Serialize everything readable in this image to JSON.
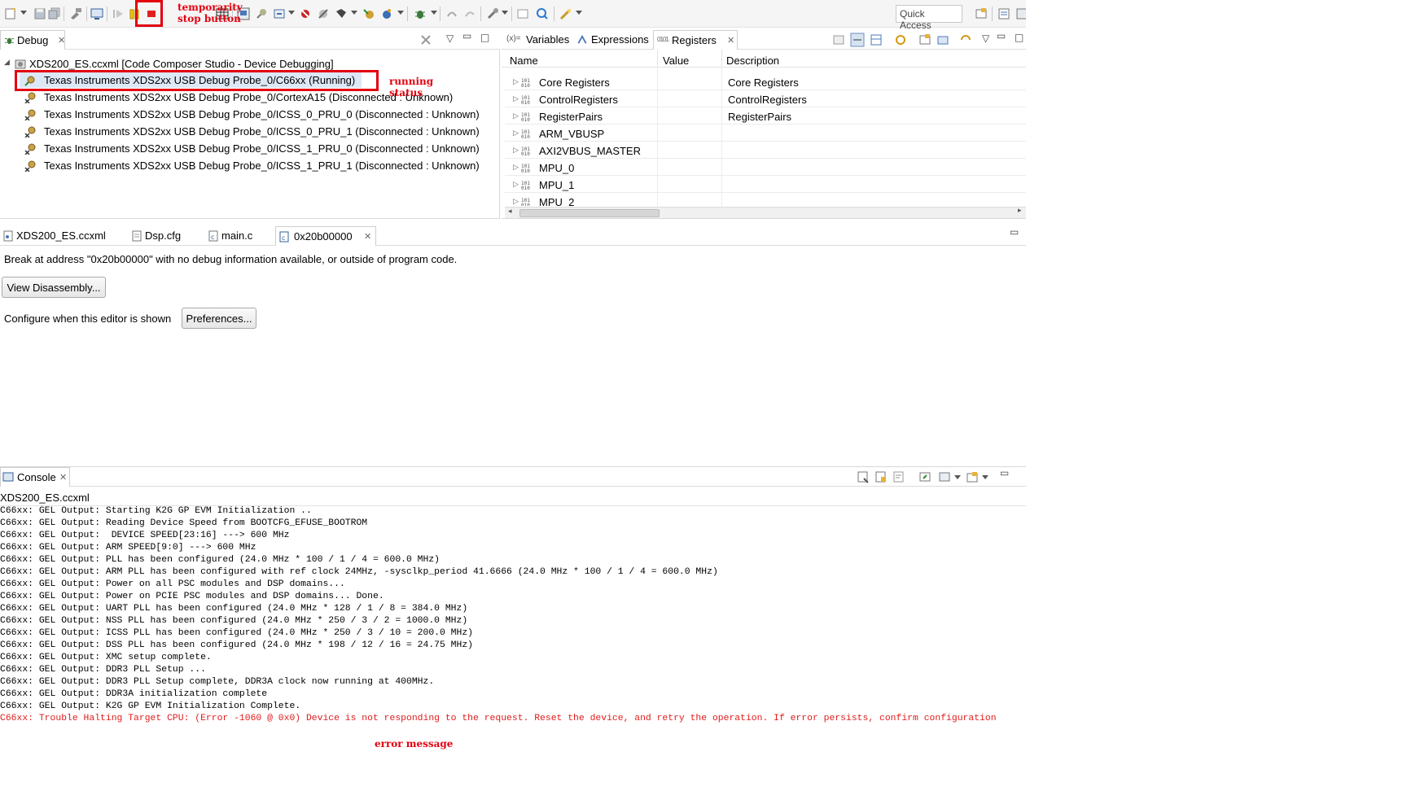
{
  "toolbar": {
    "quick_access": "Quick Access"
  },
  "debug_view": {
    "tab_label": "Debug",
    "root": "XDS200_ES.ccxml [Code Composer Studio - Device Debugging]",
    "items": [
      "Texas Instruments XDS2xx USB Debug Probe_0/C66xx (Running)",
      "Texas Instruments XDS2xx USB Debug Probe_0/CortexA15 (Disconnected : Unknown)",
      "Texas Instruments XDS2xx USB Debug Probe_0/ICSS_0_PRU_0 (Disconnected : Unknown)",
      "Texas Instruments XDS2xx USB Debug Probe_0/ICSS_0_PRU_1 (Disconnected : Unknown)",
      "Texas Instruments XDS2xx USB Debug Probe_0/ICSS_1_PRU_0 (Disconnected : Unknown)",
      "Texas Instruments XDS2xx USB Debug Probe_0/ICSS_1_PRU_1 (Disconnected : Unknown)"
    ]
  },
  "registers_view": {
    "tabs": [
      "Variables",
      "Expressions",
      "Registers"
    ],
    "columns": [
      "Name",
      "Value",
      "Description"
    ],
    "rows": [
      {
        "name": "Core Registers",
        "description": "Core Registers"
      },
      {
        "name": "ControlRegisters",
        "description": "ControlRegisters"
      },
      {
        "name": "RegisterPairs",
        "description": "RegisterPairs"
      },
      {
        "name": "ARM_VBUSP",
        "description": ""
      },
      {
        "name": "AXI2VBUS_MASTER",
        "description": ""
      },
      {
        "name": "MPU_0",
        "description": ""
      },
      {
        "name": "MPU_1",
        "description": ""
      },
      {
        "name": "MPU_2",
        "description": ""
      }
    ]
  },
  "editor": {
    "tabs": [
      "XDS200_ES.ccxml",
      "Dsp.cfg",
      "main.c",
      "0x20b00000"
    ],
    "message": "Break at address \"0x20b00000\" with no debug information available, or outside of program code.",
    "view_disassembly": "View Disassembly...",
    "configure_label": "Configure when this editor is shown",
    "preferences": "Preferences..."
  },
  "console": {
    "tab_label": "Console",
    "source": "XDS200_ES.ccxml",
    "lines": [
      "C66xx: GEL Output: Starting K2G GP EVM Initialization ..",
      "C66xx: GEL Output: Reading Device Speed from BOOTCFG_EFUSE_BOOTROM",
      "C66xx: GEL Output:  DEVICE SPEED[23:16] ---> 600 MHz",
      "C66xx: GEL Output: ARM SPEED[9:0] ---> 600 MHz",
      "C66xx: GEL Output: PLL has been configured (24.0 MHz * 100 / 1 / 4 = 600.0 MHz)",
      "C66xx: GEL Output: ARM PLL has been configured with ref clock 24MHz, -sysclkp_period 41.6666 (24.0 MHz * 100 / 1 / 4 = 600.0 MHz)",
      "C66xx: GEL Output: Power on all PSC modules and DSP domains...",
      "C66xx: GEL Output: Power on PCIE PSC modules and DSP domains... Done.",
      "C66xx: GEL Output: UART PLL has been configured (24.0 MHz * 128 / 1 / 8 = 384.0 MHz)",
      "C66xx: GEL Output: NSS PLL has been configured (24.0 MHz * 250 / 3 / 2 = 1000.0 MHz)",
      "C66xx: GEL Output: ICSS PLL has been configured (24.0 MHz * 250 / 3 / 10 = 200.0 MHz)",
      "C66xx: GEL Output: DSS PLL has been configured (24.0 MHz * 198 / 12 / 16 = 24.75 MHz)",
      "C66xx: GEL Output: XMC setup complete.",
      "C66xx: GEL Output: DDR3 PLL Setup ...",
      "C66xx: GEL Output: DDR3 PLL Setup complete, DDR3A clock now running at 400MHz.",
      "C66xx: GEL Output: DDR3A initialization complete",
      "C66xx: GEL Output: K2G GP EVM Initialization Complete."
    ],
    "error_line": "C66xx: Trouble Halting Target CPU: (Error -1060 @ 0x0) Device is not responding to the request. Reset the device, and retry the operation. If error persists, confirm configuration"
  },
  "annotations": {
    "stop_button": "temporarity\nstop button",
    "running_status": "running\nstatus",
    "error_message": "error message"
  },
  "colors": {
    "annotation": "#e3000f",
    "error_text": "#e01b1b",
    "selection": "#dde8f6"
  }
}
